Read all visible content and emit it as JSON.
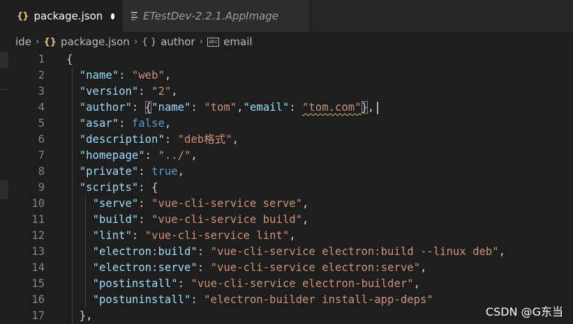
{
  "tabs": [
    {
      "icon": "{}",
      "label": "package.json",
      "active": true,
      "modified": true
    },
    {
      "icon": "lines-icon",
      "label": "ETestDev-2.2.1.AppImage",
      "active": false,
      "italic": true
    }
  ],
  "breadcrumb": [
    {
      "icon": "",
      "label": "ide"
    },
    {
      "icon": "{}",
      "label": "package.json"
    },
    {
      "icon": "{ }",
      "label": "author"
    },
    {
      "icon": "abc",
      "label": "email"
    }
  ],
  "lines": [
    {
      "n": "1",
      "tokens": [
        [
          "punct",
          "{"
        ]
      ]
    },
    {
      "n": "2",
      "tokens": [
        [
          "punct",
          "  "
        ],
        [
          "key",
          "\"name\""
        ],
        [
          "punct",
          ": "
        ],
        [
          "str",
          "\"web\""
        ],
        [
          "punct",
          ","
        ]
      ]
    },
    {
      "n": "3",
      "tokens": [
        [
          "punct",
          "  "
        ],
        [
          "key",
          "\"version\""
        ],
        [
          "punct",
          ": "
        ],
        [
          "str",
          "\"2\""
        ],
        [
          "punct",
          ","
        ]
      ]
    },
    {
      "n": "4",
      "tokens": [
        [
          "punct",
          "  "
        ],
        [
          "key",
          "\"author\""
        ],
        [
          "punct",
          ": "
        ],
        [
          "punct",
          "{"
        ],
        [
          "key",
          "\"name\""
        ],
        [
          "punct",
          ": "
        ],
        [
          "str",
          "\"tom\""
        ],
        [
          "punct",
          ","
        ],
        [
          "key",
          "\"email\""
        ],
        [
          "punct",
          ": "
        ],
        [
          "str",
          "\"tom.com\""
        ],
        [
          "punct",
          "}"
        ],
        [
          "punct",
          ","
        ]
      ]
    },
    {
      "n": "5",
      "tokens": [
        [
          "punct",
          "  "
        ],
        [
          "key",
          "\"asar\""
        ],
        [
          "punct",
          ": "
        ],
        [
          "kw",
          "false"
        ],
        [
          "punct",
          ","
        ]
      ]
    },
    {
      "n": "6",
      "tokens": [
        [
          "punct",
          "  "
        ],
        [
          "key",
          "\"description\""
        ],
        [
          "punct",
          ": "
        ],
        [
          "str",
          "\"deb格式\""
        ],
        [
          "punct",
          ","
        ]
      ]
    },
    {
      "n": "7",
      "tokens": [
        [
          "punct",
          "  "
        ],
        [
          "key",
          "\"homepage\""
        ],
        [
          "punct",
          ": "
        ],
        [
          "str",
          "\"../\""
        ],
        [
          "punct",
          ","
        ]
      ]
    },
    {
      "n": "8",
      "tokens": [
        [
          "punct",
          "  "
        ],
        [
          "key",
          "\"private\""
        ],
        [
          "punct",
          ": "
        ],
        [
          "kw",
          "true"
        ],
        [
          "punct",
          ","
        ]
      ]
    },
    {
      "n": "9",
      "tokens": [
        [
          "punct",
          "  "
        ],
        [
          "key",
          "\"scripts\""
        ],
        [
          "punct",
          ": {"
        ]
      ]
    },
    {
      "n": "10",
      "tokens": [
        [
          "punct",
          "    "
        ],
        [
          "key",
          "\"serve\""
        ],
        [
          "punct",
          ": "
        ],
        [
          "str",
          "\"vue-cli-service serve\""
        ],
        [
          "punct",
          ","
        ]
      ]
    },
    {
      "n": "11",
      "tokens": [
        [
          "punct",
          "    "
        ],
        [
          "key",
          "\"build\""
        ],
        [
          "punct",
          ": "
        ],
        [
          "str",
          "\"vue-cli-service build\""
        ],
        [
          "punct",
          ","
        ]
      ]
    },
    {
      "n": "12",
      "tokens": [
        [
          "punct",
          "    "
        ],
        [
          "key",
          "\"lint\""
        ],
        [
          "punct",
          ": "
        ],
        [
          "str",
          "\"vue-cli-service lint\""
        ],
        [
          "punct",
          ","
        ]
      ]
    },
    {
      "n": "13",
      "tokens": [
        [
          "punct",
          "    "
        ],
        [
          "key",
          "\"electron:build\""
        ],
        [
          "punct",
          ": "
        ],
        [
          "str",
          "\"vue-cli-service electron:build --linux deb\""
        ],
        [
          "punct",
          ","
        ]
      ]
    },
    {
      "n": "14",
      "tokens": [
        [
          "punct",
          "    "
        ],
        [
          "key",
          "\"electron:serve\""
        ],
        [
          "punct",
          ": "
        ],
        [
          "str",
          "\"vue-cli-service electron:serve\""
        ],
        [
          "punct",
          ","
        ]
      ]
    },
    {
      "n": "15",
      "tokens": [
        [
          "punct",
          "    "
        ],
        [
          "key",
          "\"postinstall\""
        ],
        [
          "punct",
          ": "
        ],
        [
          "str",
          "\"vue-cli-service electron-builder\""
        ],
        [
          "punct",
          ","
        ]
      ]
    },
    {
      "n": "16",
      "tokens": [
        [
          "punct",
          "    "
        ],
        [
          "key",
          "\"postuninstall\""
        ],
        [
          "punct",
          ": "
        ],
        [
          "str",
          "\"electron-builder install-app-deps\""
        ]
      ]
    },
    {
      "n": "17",
      "tokens": [
        [
          "punct",
          "  "
        ],
        [
          "punct",
          "},"
        ]
      ]
    }
  ],
  "watermark": "CSDN @G东当",
  "colors": {
    "background": "#1e1e1e",
    "key": "#9cdcfe",
    "string": "#ce9178",
    "keyword": "#569cd6",
    "punctuation": "#d4d4d4",
    "line_number": "#858585",
    "json_icon": "#e5c07b"
  }
}
